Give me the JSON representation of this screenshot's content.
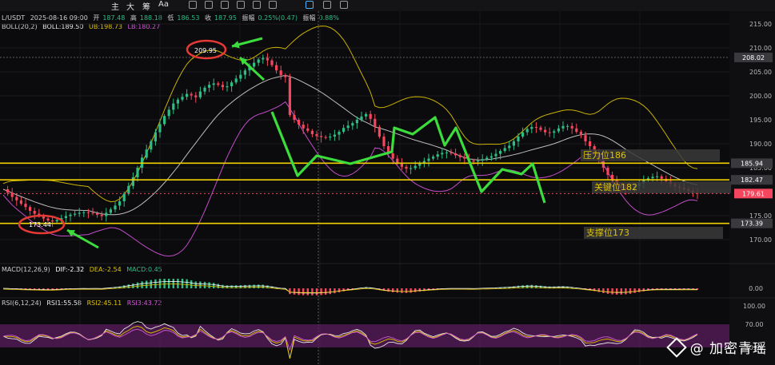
{
  "toolbar": {
    "time_label": "时间",
    "buttons": [
      "主",
      "大",
      "筹",
      "Aa"
    ],
    "icons": [
      "candle-icon",
      "pencil-icon",
      "ruler-icon",
      "link-icon",
      "eye-icon",
      "lock-icon",
      "highlighter-icon",
      "filter-icon",
      "trash-icon"
    ]
  },
  "info": {
    "symbol": "L/USDT",
    "date": "2025-08-16 09:00",
    "open_label": "开",
    "open": "187.48",
    "high_label": "高",
    "high": "188.18",
    "low_label": "低",
    "low": "186.53",
    "close_label": "收",
    "close": "187.95",
    "change_label": "振幅",
    "change": "0.25%(0.47)",
    "amp_label": "振幅",
    "amp": "0.88%",
    "boll": "BOLL(20,2)",
    "boll_mid": "BOLL:189.50",
    "boll_ub": "UB:198.73",
    "boll_lb": "LB:180.27"
  },
  "macd_info": {
    "label": "MACD(12,26,9)",
    "dif": "DIF:-2.32",
    "dea": "DEA:-2.54",
    "macd": "MACD:0.45"
  },
  "rsi_info": {
    "label": "RSI(6,12,24)",
    "rsi1": "RSI1:55.58",
    "rsi2": "RSI2:45.11",
    "rsi3": "RSI3:43.72"
  },
  "colors": {
    "bull": "#2ebd85",
    "bear": "#f6465d",
    "hline": "#f0d000",
    "arrow": "#3ddc3d",
    "circle": "#e53935",
    "boll_upper": "#c8b200",
    "boll_mid": "#bdbdbd",
    "boll_lower": "#c24bc8"
  },
  "chart_data": {
    "type": "candlestick",
    "y_ticks": [
      "215.00",
      "210.00",
      "205.00",
      "200.00",
      "195.00",
      "190.00",
      "185.00",
      "180.00",
      "175.00",
      "170.00"
    ],
    "ylim": [
      167,
      217
    ],
    "current_price": "179.61",
    "crosshair_price": "208.02",
    "levels": [
      {
        "price_tag": "185.94",
        "label": "压力位186"
      },
      {
        "price_tag": "182.47",
        "label": "关键位182"
      },
      {
        "price_tag": "173.39",
        "label": "支撑位173"
      }
    ],
    "annotations": {
      "high": "209.95",
      "low": "173.44"
    },
    "macd_ticks": [
      "0.00"
    ],
    "rsi_ticks": [
      "100.00",
      "70.00",
      "30.00"
    ],
    "close_series": [
      180.5,
      179.8,
      178.9,
      178.2,
      177.5,
      176.8,
      176.0,
      175.4,
      175.0,
      174.4,
      174.0,
      173.8,
      174.1,
      174.5,
      174.9,
      175.2,
      175.4,
      175.6,
      175.7,
      175.6,
      175.5,
      175.2,
      174.9,
      175.6,
      176.3,
      177.1,
      178.0,
      179.6,
      181.2,
      183.0,
      185.0,
      187.1,
      188.8,
      190.5,
      192.4,
      194.1,
      195.8,
      197.1,
      198.4,
      199.2,
      199.8,
      200.4,
      200.1,
      199.7,
      200.9,
      201.7,
      202.3,
      202.6,
      202.3,
      201.8,
      202.0,
      202.8,
      203.6,
      204.4,
      205.3,
      206.1,
      206.9,
      207.6,
      207.9,
      207.4,
      206.4,
      205.3,
      204.3,
      203.9,
      196.0,
      195.0,
      194.0,
      193.2,
      192.7,
      192.0,
      191.6,
      191.4,
      191.3,
      191.5,
      191.9,
      192.5,
      193.3,
      193.8,
      194.3,
      195.0,
      195.7,
      196.2,
      195.2,
      193.5,
      191.5,
      189.5,
      188.0,
      186.9,
      186.0,
      185.2,
      184.8,
      184.9,
      185.4,
      186.0,
      186.4,
      186.9,
      187.3,
      187.8,
      188.1,
      188.2,
      188.0,
      187.6,
      187.2,
      186.9,
      186.5,
      186.3,
      186.5,
      186.8,
      187.1,
      187.4,
      187.9,
      188.5,
      189.1,
      189.6,
      190.5,
      191.5,
      192.4,
      193.1,
      193.5,
      193.4,
      192.9,
      192.4,
      192.3,
      192.6,
      193.2,
      193.7,
      193.7,
      193.2,
      192.5,
      191.8,
      190.5,
      189.5,
      188.2,
      186.7,
      185.0,
      183.5,
      182.3,
      181.4,
      180.8,
      180.5,
      180.6,
      181.2,
      181.8,
      182.4,
      182.8,
      183.1,
      183.2,
      182.7,
      182.2,
      181.6,
      181.1,
      180.8,
      180.5,
      180.2,
      179.8,
      179.6
    ]
  }
}
